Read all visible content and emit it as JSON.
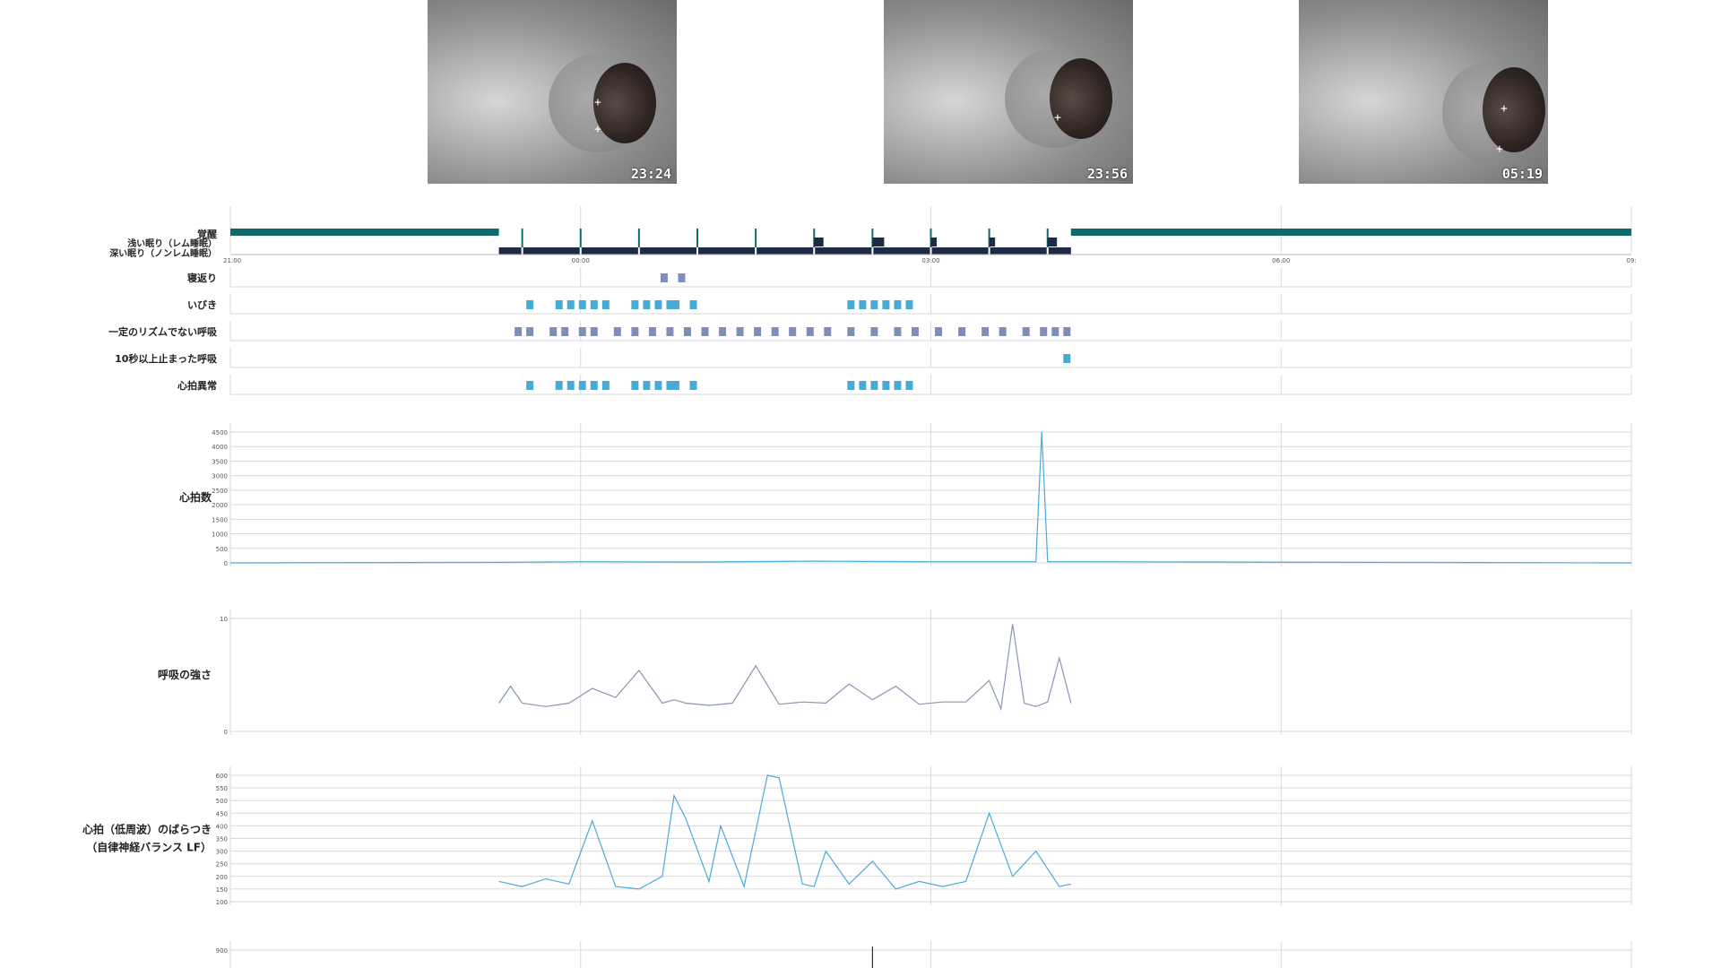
{
  "thumbnails": [
    {
      "time": "23:24"
    },
    {
      "time": "23:56"
    },
    {
      "time": "05:19"
    }
  ],
  "colors": {
    "awake": "#0f6b6b",
    "sleep": "#1f2a44",
    "events": "#4aaad6",
    "irregular": "#7d8fb8",
    "heart": "#4aaad6",
    "breath": "#8896b4",
    "lf": "#4aaad6",
    "grid": "#d9d9d9"
  },
  "chart_data": [
    {
      "type": "timeline",
      "levels": [
        "覚醒",
        "浅い眠り（レム睡眠）",
        "深い眠り（ノンレム睡眠）"
      ],
      "x_ticks": [
        "21:00",
        "00:00",
        "03:00",
        "06:00",
        "09:"
      ],
      "x_range_hours": [
        21,
        33
      ],
      "segments": [
        {
          "state": "覚醒",
          "start": 21.0,
          "end": 23.3
        },
        {
          "state": "深い眠り（ノンレム睡眠）",
          "start": 23.3,
          "end": 28.2
        },
        {
          "state": "覚醒",
          "start": 28.2,
          "end": 33.0
        }
      ],
      "brief_arousals": [
        23.5,
        24.0,
        24.5,
        25.0,
        25.5,
        26.0,
        26.5,
        27.0,
        27.5,
        28.0
      ],
      "rem_bouts": [
        [
          26.0,
          26.08
        ],
        [
          26.5,
          26.6
        ],
        [
          27.0,
          27.05
        ],
        [
          27.5,
          27.55
        ],
        [
          28.0,
          28.08
        ]
      ]
    },
    {
      "type": "event-track",
      "rows": [
        {
          "label": "寝返り",
          "events": [
            24.7,
            24.85
          ]
        },
        {
          "label": "いびき",
          "events": [
            23.55,
            23.8,
            23.9,
            24.0,
            24.1,
            24.2,
            24.45,
            24.55,
            24.65,
            24.75,
            24.8,
            24.95,
            26.3,
            26.4,
            26.5,
            26.6,
            26.7,
            26.8
          ]
        },
        {
          "label": "一定のリズムでない呼吸",
          "events": [
            23.45,
            23.55,
            23.75,
            23.85,
            24.0,
            24.1,
            24.3,
            24.45,
            24.6,
            24.75,
            24.9,
            25.05,
            25.2,
            25.35,
            25.5,
            25.65,
            25.8,
            25.95,
            26.1,
            26.3,
            26.5,
            26.7,
            26.85,
            27.05,
            27.25,
            27.45,
            27.6,
            27.8,
            27.95,
            28.05,
            28.15
          ]
        },
        {
          "label": "10秒以上止まった呼吸",
          "events": [
            28.15
          ]
        },
        {
          "label": "心拍異常",
          "events": [
            23.55,
            23.8,
            23.9,
            24.0,
            24.1,
            24.2,
            24.45,
            24.55,
            24.65,
            24.75,
            24.8,
            24.95,
            26.3,
            26.4,
            26.5,
            26.6,
            26.7,
            26.8
          ]
        }
      ]
    },
    {
      "type": "line",
      "ylabel": "心拍数",
      "ylim": [
        0,
        4500
      ],
      "y_ticks": [
        0,
        500,
        1000,
        1500,
        2000,
        2500,
        3000,
        3500,
        4000,
        4500
      ],
      "series": [
        {
          "x": [
            21.0,
            23.3,
            24.0,
            25.0,
            26.0,
            27.0,
            27.9,
            27.95,
            28.0,
            28.3,
            33.0
          ],
          "values": [
            0,
            20,
            40,
            30,
            60,
            40,
            40,
            4500,
            40,
            40,
            0
          ]
        }
      ]
    },
    {
      "type": "line",
      "ylabel": "呼吸の強さ",
      "ylim": [
        0,
        10
      ],
      "y_ticks": [
        0,
        10
      ],
      "series": [
        {
          "x": [
            23.3,
            23.4,
            23.5,
            23.7,
            23.9,
            24.1,
            24.3,
            24.5,
            24.7,
            24.8,
            24.9,
            25.1,
            25.3,
            25.5,
            25.7,
            25.9,
            26.1,
            26.3,
            26.5,
            26.7,
            26.9,
            27.1,
            27.3,
            27.5,
            27.6,
            27.7,
            27.8,
            27.9,
            28.0,
            28.1,
            28.2
          ],
          "values": [
            2.5,
            4.0,
            2.5,
            2.2,
            2.5,
            3.8,
            3.0,
            5.4,
            2.5,
            2.8,
            2.5,
            2.3,
            2.5,
            5.8,
            2.4,
            2.6,
            2.5,
            4.2,
            2.8,
            4.0,
            2.4,
            2.6,
            2.6,
            4.5,
            2.0,
            9.5,
            2.5,
            2.2,
            2.6,
            6.5,
            2.5
          ]
        }
      ]
    },
    {
      "type": "line",
      "ylabel": "心拍（低周波）のばらつき（自律神経バランス LF）",
      "ylim": [
        100,
        600
      ],
      "y_ticks": [
        100,
        150,
        200,
        250,
        300,
        350,
        400,
        450,
        500,
        550,
        600
      ],
      "series": [
        {
          "x": [
            23.3,
            23.5,
            23.7,
            23.9,
            24.1,
            24.3,
            24.5,
            24.7,
            24.8,
            24.9,
            25.1,
            25.2,
            25.4,
            25.6,
            25.7,
            25.9,
            26.0,
            26.1,
            26.3,
            26.5,
            26.7,
            26.9,
            27.1,
            27.3,
            27.5,
            27.7,
            27.9,
            28.1,
            28.2
          ],
          "values": [
            180,
            160,
            190,
            170,
            420,
            160,
            150,
            200,
            520,
            430,
            180,
            400,
            160,
            600,
            590,
            170,
            160,
            300,
            170,
            260,
            150,
            180,
            160,
            180,
            450,
            200,
            300,
            160,
            170
          ]
        }
      ]
    },
    {
      "type": "line",
      "y_ticks": [
        800,
        900
      ],
      "ylim": [
        700,
        900
      ]
    }
  ]
}
